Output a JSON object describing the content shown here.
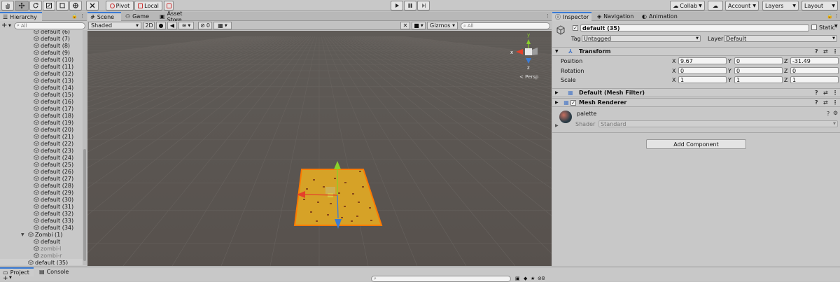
{
  "toolbar": {
    "pivot_label": "Pivot",
    "local_label": "Local",
    "collab_label": "Collab",
    "account_label": "Account",
    "layers_label": "Layers",
    "layout_label": "Layout"
  },
  "hierarchy": {
    "tab_label": "Hierarchy",
    "search_placeholder": "All",
    "items": [
      {
        "label": "default (6)",
        "dim": false
      },
      {
        "label": "default (7)",
        "dim": false
      },
      {
        "label": "default (8)",
        "dim": false
      },
      {
        "label": "default (9)",
        "dim": false
      },
      {
        "label": "default (10)",
        "dim": false
      },
      {
        "label": "default (11)",
        "dim": false
      },
      {
        "label": "default (12)",
        "dim": false
      },
      {
        "label": "default (13)",
        "dim": false
      },
      {
        "label": "default (14)",
        "dim": false
      },
      {
        "label": "default (15)",
        "dim": false
      },
      {
        "label": "default (16)",
        "dim": false
      },
      {
        "label": "default (17)",
        "dim": false
      },
      {
        "label": "default (18)",
        "dim": false
      },
      {
        "label": "default (19)",
        "dim": false
      },
      {
        "label": "default (20)",
        "dim": false
      },
      {
        "label": "default (21)",
        "dim": false
      },
      {
        "label": "default (22)",
        "dim": false
      },
      {
        "label": "default (23)",
        "dim": false
      },
      {
        "label": "default (24)",
        "dim": false
      },
      {
        "label": "default (25)",
        "dim": false
      },
      {
        "label": "default (26)",
        "dim": false
      },
      {
        "label": "default (27)",
        "dim": false
      },
      {
        "label": "default (28)",
        "dim": false
      },
      {
        "label": "default (29)",
        "dim": false
      },
      {
        "label": "default (30)",
        "dim": false
      },
      {
        "label": "default (31)",
        "dim": false
      },
      {
        "label": "default (32)",
        "dim": false
      },
      {
        "label": "default (33)",
        "dim": false
      },
      {
        "label": "default (34)",
        "dim": false
      }
    ],
    "zombi": {
      "label": "Zombi (1)",
      "children": [
        {
          "label": "default",
          "dim": false
        },
        {
          "label": "zombi-l",
          "dim": true
        },
        {
          "label": "zombi-r",
          "dim": true
        }
      ]
    },
    "last": {
      "label": "default (35)"
    }
  },
  "scene": {
    "tabs": [
      "Scene",
      "Game",
      "Asset Store"
    ],
    "shading": "Shaded",
    "mode_2d": "2D",
    "hidden_count": "0",
    "gizmos_label": "Gizmos",
    "search_placeholder": "All",
    "axis_y": "y",
    "axis_x": "x",
    "axis_z": "z",
    "persp_label": "Persp"
  },
  "inspector": {
    "tabs": [
      "Inspector",
      "Navigation",
      "Animation"
    ],
    "object_name": "default (35)",
    "static_label": "Static",
    "tag_label": "Tag",
    "tag_value": "Untagged",
    "layer_label": "Layer",
    "layer_value": "Default",
    "transform": {
      "title": "Transform",
      "position_label": "Position",
      "rotation_label": "Rotation",
      "scale_label": "Scale",
      "x_label": "X",
      "y_label": "Y",
      "z_label": "Z",
      "position": [
        "9.67",
        "0",
        "-31.49"
      ],
      "rotation": [
        "0",
        "0",
        "0"
      ],
      "scale": [
        "1",
        "1",
        "1"
      ]
    },
    "mesh_filter_title": "Default (Mesh Filter)",
    "mesh_renderer_title": "Mesh Renderer",
    "material_name": "palette",
    "shader_label": "Shader",
    "shader_value": "Standard",
    "add_component_label": "Add Component"
  },
  "bottom": {
    "project_tab": "Project",
    "console_tab": "Console",
    "badge_count": "8"
  },
  "colors": {
    "accent": "#3a7bd5",
    "scene_sky": "#5e5a56",
    "scene_ground": "#534d49",
    "selection_fill": "#d9a62a",
    "selection_outline": "#ff7a00",
    "axis_x": "#e5402a",
    "axis_y": "#8ad12a",
    "axis_z": "#3a7bd5"
  }
}
